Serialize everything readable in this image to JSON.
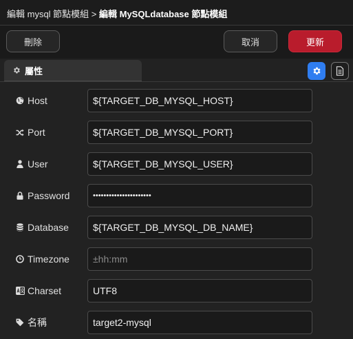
{
  "breadcrumb": {
    "parent": "編輯 mysql 節點模組",
    "separator": ">",
    "current": "編輯 MySQLdatabase 節點模組"
  },
  "actions": {
    "delete_label": "刪除",
    "cancel_label": "取消",
    "update_label": "更新"
  },
  "tabs": [
    {
      "label": "屬性",
      "icon": "gear-icon"
    }
  ],
  "colors": {
    "update_button": "#b91c2c",
    "settings_button": "#2f7df0"
  },
  "fields": [
    {
      "label": "Host",
      "icon": "globe-icon",
      "value": "${TARGET_DB_MYSQL_HOST}",
      "placeholder": ""
    },
    {
      "label": "Port",
      "icon": "random-icon",
      "value": "${TARGET_DB_MYSQL_PORT}",
      "placeholder": ""
    },
    {
      "label": "User",
      "icon": "user-icon",
      "value": "${TARGET_DB_MYSQL_USER}",
      "placeholder": ""
    },
    {
      "label": "Password",
      "icon": "lock-icon",
      "value": "••••••••••••••••••••••",
      "placeholder": ""
    },
    {
      "label": "Database",
      "icon": "database-icon",
      "value": "${TARGET_DB_MYSQL_DB_NAME}",
      "placeholder": ""
    },
    {
      "label": "Timezone",
      "icon": "clock-icon",
      "value": "",
      "placeholder": "±hh:mm"
    },
    {
      "label": "Charset",
      "icon": "language-icon",
      "value": "UTF8",
      "placeholder": ""
    },
    {
      "label": "名稱",
      "icon": "tag-icon",
      "value": "target2-mysql",
      "placeholder": ""
    }
  ]
}
